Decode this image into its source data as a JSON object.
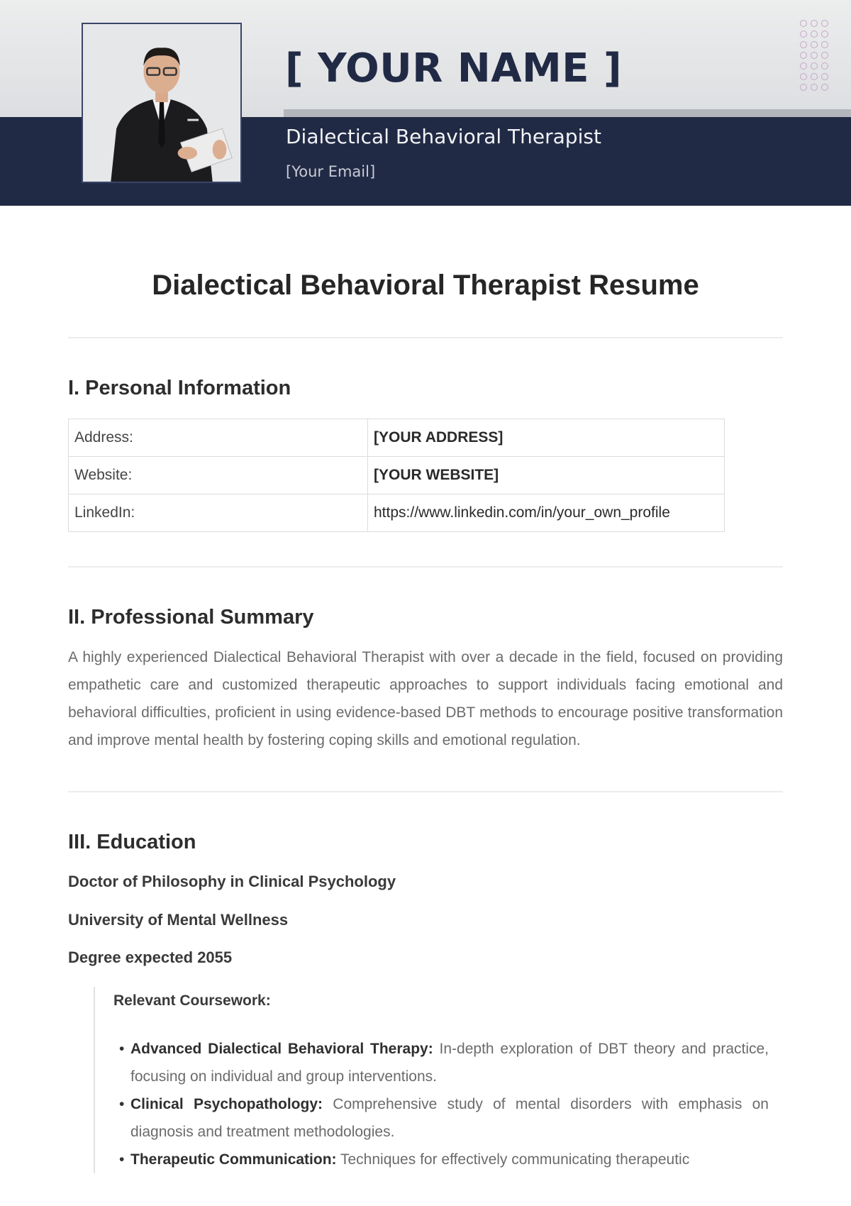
{
  "header": {
    "name": "[ YOUR NAME ]",
    "job_title": "Dialectical Behavioral Therapist",
    "email": "[Your Email]",
    "photo_alt": "Professional headshot of man in suit holding tablet",
    "colors": {
      "navy": "#212a45",
      "light": "#e3e4e6",
      "accent_gray": "#b3b6bd",
      "dots": "#c7a6c9"
    }
  },
  "document": {
    "title": "Dialectical Behavioral Therapist Resume"
  },
  "personal_information": {
    "heading": "I. Personal Information",
    "rows": [
      {
        "label": "Address:",
        "value": "[YOUR ADDRESS]",
        "bold": true
      },
      {
        "label": "Website:",
        "value": "[YOUR WEBSITE]",
        "bold": true
      },
      {
        "label": "LinkedIn:",
        "value": "https://www.linkedin.com/in/your_own_profile",
        "bold": false
      }
    ]
  },
  "professional_summary": {
    "heading": "II. Professional Summary",
    "text": "A highly experienced Dialectical Behavioral Therapist with over a decade in the field, focused on providing empathetic care and customized therapeutic approaches to support individuals facing emotional and behavioral difficulties, proficient in using evidence-based DBT methods to encourage positive transformation and improve mental health by fostering coping skills and emotional regulation."
  },
  "education": {
    "heading": "III. Education",
    "degree": "Doctor of Philosophy in Clinical Psychology",
    "school": "University of Mental Wellness",
    "expected": "Degree expected 2055",
    "coursework_label": "Relevant Coursework:",
    "courses": [
      {
        "name": "Advanced Dialectical Behavioral Therapy:",
        "desc": "In-depth exploration of DBT theory and practice, focusing on individual and group interventions."
      },
      {
        "name": "Clinical Psychopathology:",
        "desc": "Comprehensive study of mental disorders with emphasis on diagnosis and treatment methodologies."
      },
      {
        "name": "Therapeutic Communication:",
        "desc": "Techniques for effectively communicating therapeutic"
      }
    ]
  }
}
